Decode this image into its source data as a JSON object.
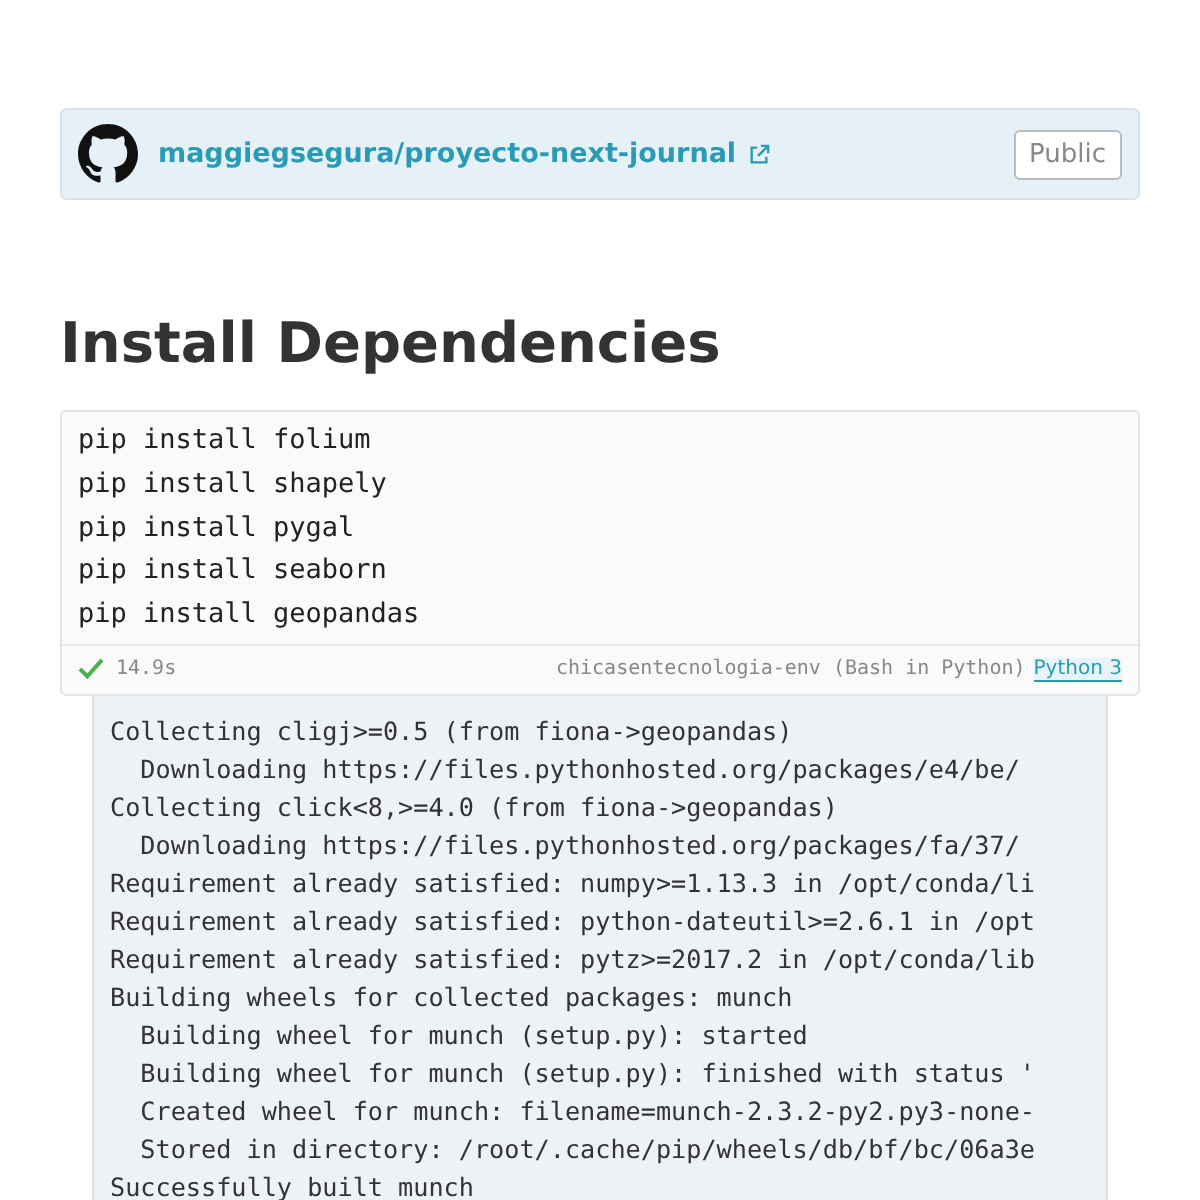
{
  "repo": {
    "name": "maggiegsegura/proyecto-next-journal",
    "visibility": "Public"
  },
  "heading": "Install Dependencies",
  "cell": {
    "code": [
      "pip install folium",
      "pip install shapely",
      "pip install pygal",
      "pip install seaborn",
      "pip install geopandas"
    ],
    "status": {
      "success": true,
      "duration": "14.9s",
      "environment": "chicasentecnologia-env (Bash in Python)",
      "language": "Python 3"
    },
    "output": [
      "Collecting cligj>=0.5 (from fiona->geopandas)",
      "  Downloading https://files.pythonhosted.org/packages/e4/be/",
      "Collecting click<8,>=4.0 (from fiona->geopandas)",
      "  Downloading https://files.pythonhosted.org/packages/fa/37/",
      "Requirement already satisfied: numpy>=1.13.3 in /opt/conda/li",
      "Requirement already satisfied: python-dateutil>=2.6.1 in /opt",
      "Requirement already satisfied: pytz>=2017.2 in /opt/conda/lib",
      "Building wheels for collected packages: munch",
      "  Building wheel for munch (setup.py): started",
      "  Building wheel for munch (setup.py): finished with status '",
      "  Created wheel for munch: filename=munch-2.3.2-py2.py3-none-",
      "  Stored in directory: /root/.cache/pip/wheels/db/bf/bc/06a3e",
      "Successfully built munch"
    ]
  }
}
